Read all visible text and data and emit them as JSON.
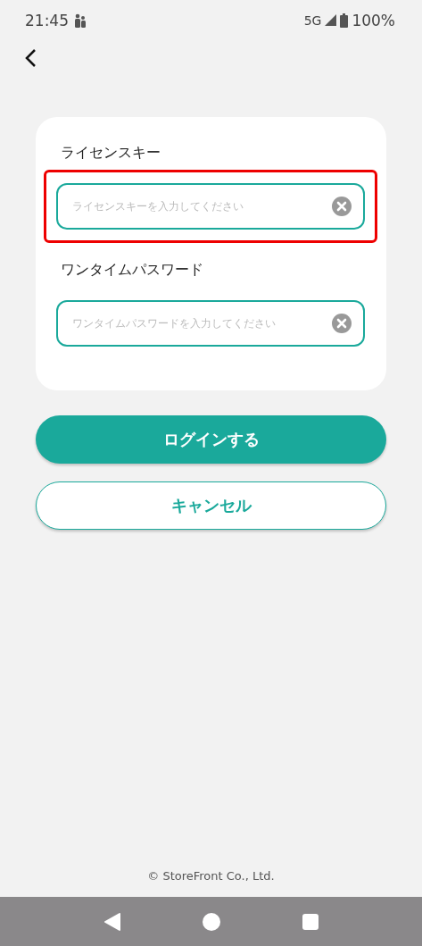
{
  "status_bar": {
    "time": "21:45",
    "network": "5G",
    "battery": "100%"
  },
  "fields": [
    {
      "label": "ライセンスキー",
      "placeholder": "ライセンスキーを入力してください",
      "highlighted": true
    },
    {
      "label": "ワンタイムパスワード",
      "placeholder": "ワンタイムパスワードを入力してください",
      "highlighted": false
    }
  ],
  "buttons": [
    {
      "label": "ログインする",
      "kind": "primary"
    },
    {
      "label": "キャンセル",
      "kind": "secondary"
    }
  ],
  "footer": "© StoreFront Co., Ltd."
}
